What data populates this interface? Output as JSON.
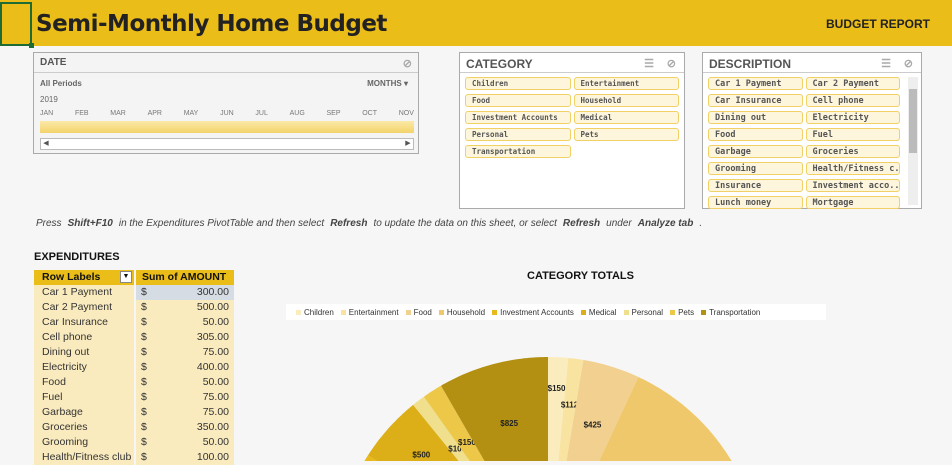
{
  "header": {
    "title": "Semi-Monthly Home Budget",
    "report_label": "BUDGET REPORT"
  },
  "date_slicer": {
    "title": "DATE",
    "period": "All Periods",
    "granularity": "MONTHS",
    "year": "2019",
    "months": [
      "JAN",
      "FEB",
      "MAR",
      "APR",
      "MAY",
      "JUN",
      "JUL",
      "AUG",
      "SEP",
      "OCT",
      "NOV"
    ]
  },
  "category_slicer": {
    "title": "CATEGORY",
    "items": [
      "Children",
      "Entertainment",
      "Food",
      "Household",
      "Investment Accounts",
      "Medical",
      "Personal",
      "Pets",
      "Transportation"
    ]
  },
  "description_slicer": {
    "title": "DESCRIPTION",
    "items": [
      "Car 1 Payment",
      "Car 2 Payment",
      "Car Insurance",
      "Cell phone",
      "Dining out",
      "Electricity",
      "Food",
      "Fuel",
      "Garbage",
      "Groceries",
      "Grooming",
      "Health/Fitness c...",
      "Insurance",
      "Investment acco...",
      "Lunch money",
      "Mortgage"
    ]
  },
  "note": {
    "p1": "Press",
    "k1": "Shift+F10",
    "p2": "in the Expenditures PivotTable and then select",
    "k2": "Refresh",
    "p3": "to update the data on this sheet, or select",
    "k3": "Refresh",
    "p4": "under",
    "k4": "Analyze tab",
    "p5": "."
  },
  "expenditures": {
    "title": "EXPENDITURES",
    "col1": "Row Labels",
    "col2": "Sum of AMOUNT",
    "currency": "$",
    "rows": [
      [
        "Car 1 Payment",
        "300.00"
      ],
      [
        "Car 2 Payment",
        "500.00"
      ],
      [
        "Car Insurance",
        "50.00"
      ],
      [
        "Cell phone",
        "305.00"
      ],
      [
        "Dining out",
        "75.00"
      ],
      [
        "Electricity",
        "400.00"
      ],
      [
        "Food",
        "50.00"
      ],
      [
        "Fuel",
        "75.00"
      ],
      [
        "Garbage",
        "75.00"
      ],
      [
        "Groceries",
        "350.00"
      ],
      [
        "Grooming",
        "50.00"
      ],
      [
        "Health/Fitness club",
        "100.00"
      ]
    ]
  },
  "chart_data": {
    "type": "pie",
    "title": "CATEGORY TOTALS",
    "legend": "top",
    "categories": [
      "Children",
      "Entertainment",
      "Food",
      "Household",
      "Investment Accounts",
      "Medical",
      "Personal",
      "Pets",
      "Transportation"
    ],
    "values": [
      150,
      112,
      425,
      6640,
      1000,
      500,
      100,
      150,
      825
    ],
    "labels": [
      "$150",
      "$112",
      "$425",
      "",
      "",
      "$500",
      "$100",
      "$150",
      "$825"
    ],
    "colors": [
      "#fbecbd",
      "#f8e3a0",
      "#f2d08f",
      "#efc86c",
      "#e9b91c",
      "#dcae18",
      "#f0df8c",
      "#ecc748",
      "#b39012"
    ]
  }
}
